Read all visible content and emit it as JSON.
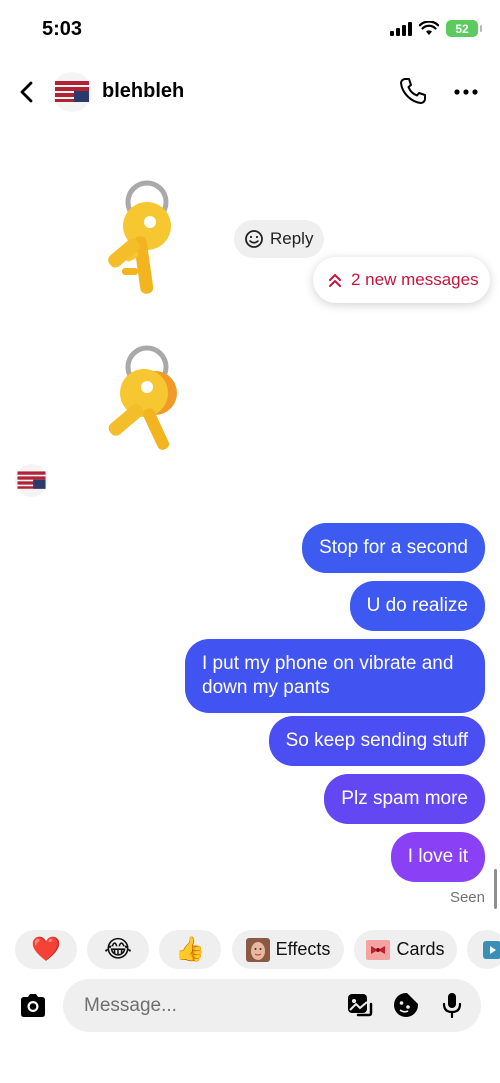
{
  "status_bar": {
    "time": "5:03",
    "battery": "52"
  },
  "header": {
    "title": "blehbleh"
  },
  "reply_chip": {
    "label": "Reply"
  },
  "new_messages": {
    "label": "2 new messages"
  },
  "messages": [
    {
      "text": "Stop for a second"
    },
    {
      "text": "U do realize"
    },
    {
      "text": "I put my phone on vibrate and down my pants"
    },
    {
      "text": "So keep sending stuff"
    },
    {
      "text": "Plz spam more"
    },
    {
      "text": "I love it"
    }
  ],
  "seen_label": "Seen",
  "quick_reactions": [
    {
      "icon": "heart-emoji",
      "glyph": "❤️"
    },
    {
      "icon": "laughing-emoji",
      "glyph": "😂"
    },
    {
      "icon": "thumbs-up-emoji",
      "glyph": "👍"
    }
  ],
  "effects_label": "Effects",
  "cards_label": "Cards",
  "composer": {
    "placeholder": "Message..."
  },
  "colors": {
    "bubble_blue": "#3d5af1",
    "bubble_purple": "#8a40f4",
    "alert_red": "#c5153e",
    "chip_gray": "#efefef"
  }
}
